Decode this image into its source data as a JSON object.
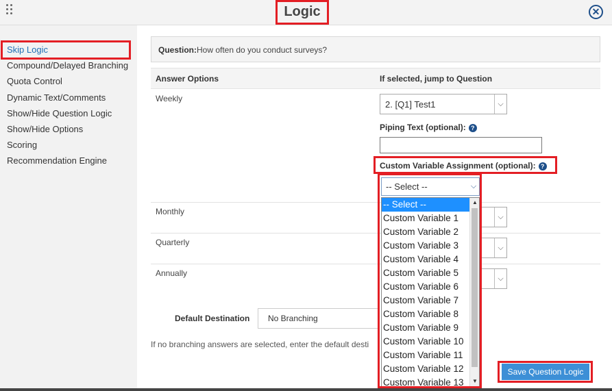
{
  "header": {
    "title": "Logic",
    "close_glyph": "✕"
  },
  "sidebar": {
    "items": [
      {
        "label": "Skip Logic",
        "active": true
      },
      {
        "label": "Compound/Delayed Branching"
      },
      {
        "label": "Quota Control"
      },
      {
        "label": "Dynamic Text/Comments"
      },
      {
        "label": "Show/Hide Question Logic"
      },
      {
        "label": "Show/Hide Options"
      },
      {
        "label": "Scoring"
      },
      {
        "label": "Recommendation Engine"
      }
    ]
  },
  "question": {
    "label": "Question:",
    "text": "How often do you conduct surveys?"
  },
  "table": {
    "col_answer": "Answer Options",
    "col_jump": "If selected, jump to Question",
    "rows": [
      {
        "answer": "Weekly",
        "jump_value": "2. [Q1] Test1"
      },
      {
        "answer": "Monthly"
      },
      {
        "answer": "Quarterly"
      },
      {
        "answer": "Annually"
      }
    ]
  },
  "piping": {
    "label": "Piping Text (optional):",
    "value": ""
  },
  "custom_variable": {
    "label": "Custom Variable Assignment (optional):",
    "selected": "-- Select --",
    "options": [
      "-- Select --",
      "Custom Variable 1",
      "Custom Variable 2",
      "Custom Variable 3",
      "Custom Variable 4",
      "Custom Variable 5",
      "Custom Variable 6",
      "Custom Variable 7",
      "Custom Variable 8",
      "Custom Variable 9",
      "Custom Variable 10",
      "Custom Variable 11",
      "Custom Variable 12",
      "Custom Variable 13"
    ]
  },
  "default_destination": {
    "label": "Default Destination",
    "value": "No Branching",
    "note": "If no branching answers are selected, enter the default desti"
  },
  "buttons": {
    "save": "Save Question Logic"
  },
  "icons": {
    "help": "?",
    "chevron": "⌵",
    "scroll_up": "▲",
    "scroll_down": "▼"
  },
  "colors": {
    "accent": "#3d8fd6",
    "highlight": "#e31e24",
    "active_link": "#1f6fb5"
  }
}
